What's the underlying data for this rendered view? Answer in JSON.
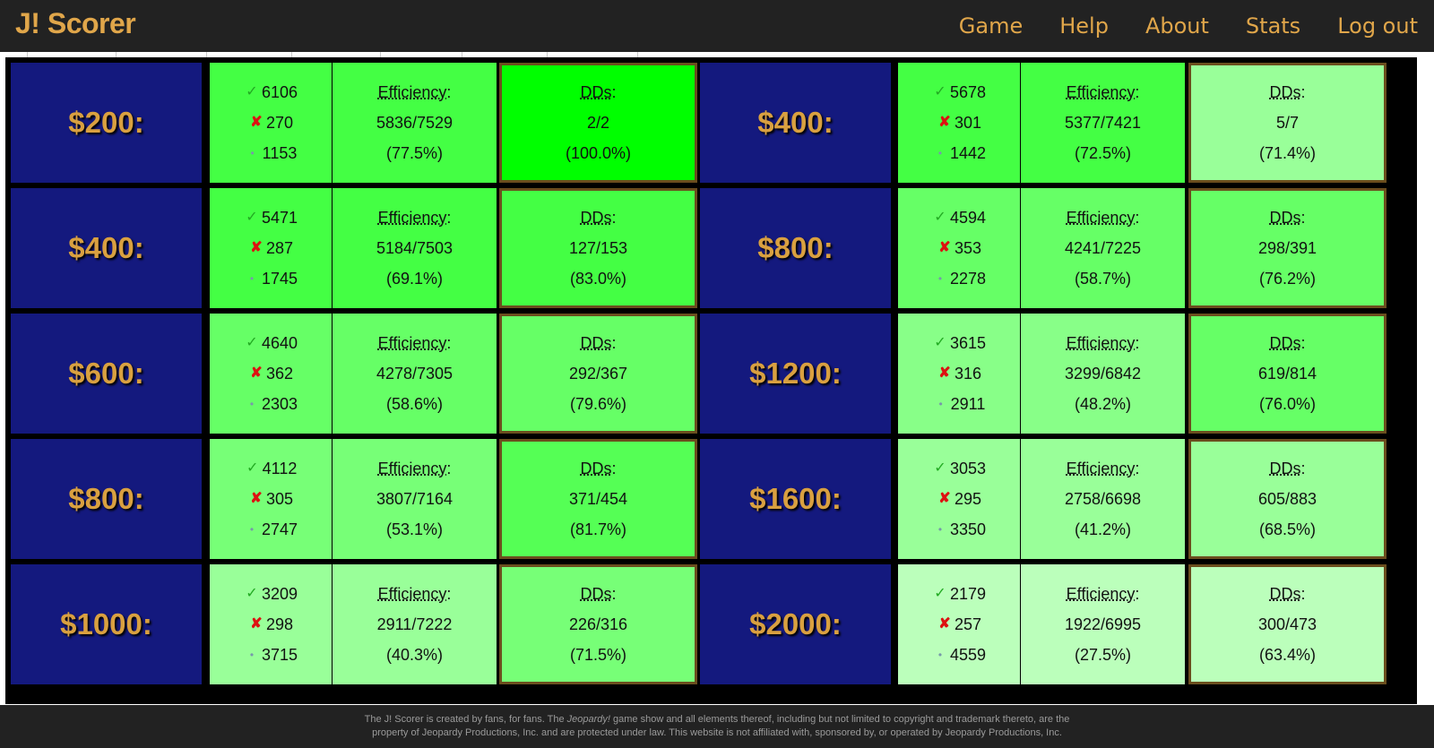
{
  "app": {
    "brand": "J! Scorer",
    "nav": [
      "Game",
      "Help",
      "About",
      "Stats",
      "Log out"
    ]
  },
  "labels": {
    "efficiency": "Efficiency",
    "dds": "DDs",
    "colon": ":"
  },
  "icons": {
    "correct": "check-icon",
    "incorrect": "cross-icon",
    "unanswered": "dot-icon"
  },
  "rows": [
    {
      "left": {
        "value": "$200:",
        "correct": "6106",
        "incorrect": "270",
        "none": "1153",
        "efficiency": "5836/7529",
        "eff_pct": "(77.5%)",
        "dd": "2/2",
        "dd_pct": "(100.0%)",
        "color_counts": "#44ff44",
        "color_eff": "#44ff44",
        "color_dd": "#00ff00"
      },
      "right": {
        "value": "$400:",
        "correct": "5678",
        "incorrect": "301",
        "none": "1442",
        "efficiency": "5377/7421",
        "eff_pct": "(72.5%)",
        "dd": "5/7",
        "dd_pct": "(71.4%)",
        "color_counts": "#44ff44",
        "color_eff": "#44ff44",
        "color_dd": "#99ff99"
      }
    },
    {
      "left": {
        "value": "$400:",
        "correct": "5471",
        "incorrect": "287",
        "none": "1745",
        "efficiency": "5184/7503",
        "eff_pct": "(69.1%)",
        "dd": "127/153",
        "dd_pct": "(83.0%)",
        "color_counts": "#44ff44",
        "color_eff": "#44ff44",
        "color_dd": "#44ff44"
      },
      "right": {
        "value": "$800:",
        "correct": "4594",
        "incorrect": "353",
        "none": "2278",
        "efficiency": "4241/7225",
        "eff_pct": "(58.7%)",
        "dd": "298/391",
        "dd_pct": "(76.2%)",
        "color_counts": "#66ff66",
        "color_eff": "#66ff66",
        "color_dd": "#66ff66"
      }
    },
    {
      "left": {
        "value": "$600:",
        "correct": "4640",
        "incorrect": "362",
        "none": "2303",
        "efficiency": "4278/7305",
        "eff_pct": "(58.6%)",
        "dd": "292/367",
        "dd_pct": "(79.6%)",
        "color_counts": "#66ff66",
        "color_eff": "#66ff66",
        "color_dd": "#66ff66"
      },
      "right": {
        "value": "$1200:",
        "correct": "3615",
        "incorrect": "316",
        "none": "2911",
        "efficiency": "3299/6842",
        "eff_pct": "(48.2%)",
        "dd": "619/814",
        "dd_pct": "(76.0%)",
        "color_counts": "#88ff88",
        "color_eff": "#88ff88",
        "color_dd": "#66ff66"
      }
    },
    {
      "left": {
        "value": "$800:",
        "correct": "4112",
        "incorrect": "305",
        "none": "2747",
        "efficiency": "3807/7164",
        "eff_pct": "(53.1%)",
        "dd": "371/454",
        "dd_pct": "(81.7%)",
        "color_counts": "#77ff77",
        "color_eff": "#77ff77",
        "color_dd": "#55ff55"
      },
      "right": {
        "value": "$1600:",
        "correct": "3053",
        "incorrect": "295",
        "none": "3350",
        "efficiency": "2758/6698",
        "eff_pct": "(41.2%)",
        "dd": "605/883",
        "dd_pct": "(68.5%)",
        "color_counts": "#99ff99",
        "color_eff": "#99ff99",
        "color_dd": "#99ff99"
      }
    },
    {
      "left": {
        "value": "$1000:",
        "correct": "3209",
        "incorrect": "298",
        "none": "3715",
        "efficiency": "2911/7222",
        "eff_pct": "(40.3%)",
        "dd": "226/316",
        "dd_pct": "(71.5%)",
        "color_counts": "#99ff99",
        "color_eff": "#99ff99",
        "color_dd": "#77ff77"
      },
      "right": {
        "value": "$2000:",
        "correct": "2179",
        "incorrect": "257",
        "none": "4559",
        "efficiency": "1922/6995",
        "eff_pct": "(27.5%)",
        "dd": "300/473",
        "dd_pct": "(63.4%)",
        "color_counts": "#bbffbb",
        "color_eff": "#bbffbb",
        "color_dd": "#bbffbb"
      }
    }
  ],
  "footer": {
    "line1_a": "The J! Scorer is created by fans, for fans. The ",
    "line1_em": "Jeopardy!",
    "line1_b": " game show and all elements thereof, including but not limited to copyright and trademark thereto, are the",
    "line2": "property of Jeopardy Productions, Inc. and are protected under law. This website is not affiliated with, sponsored by, or operated by Jeopardy Productions, Inc."
  }
}
